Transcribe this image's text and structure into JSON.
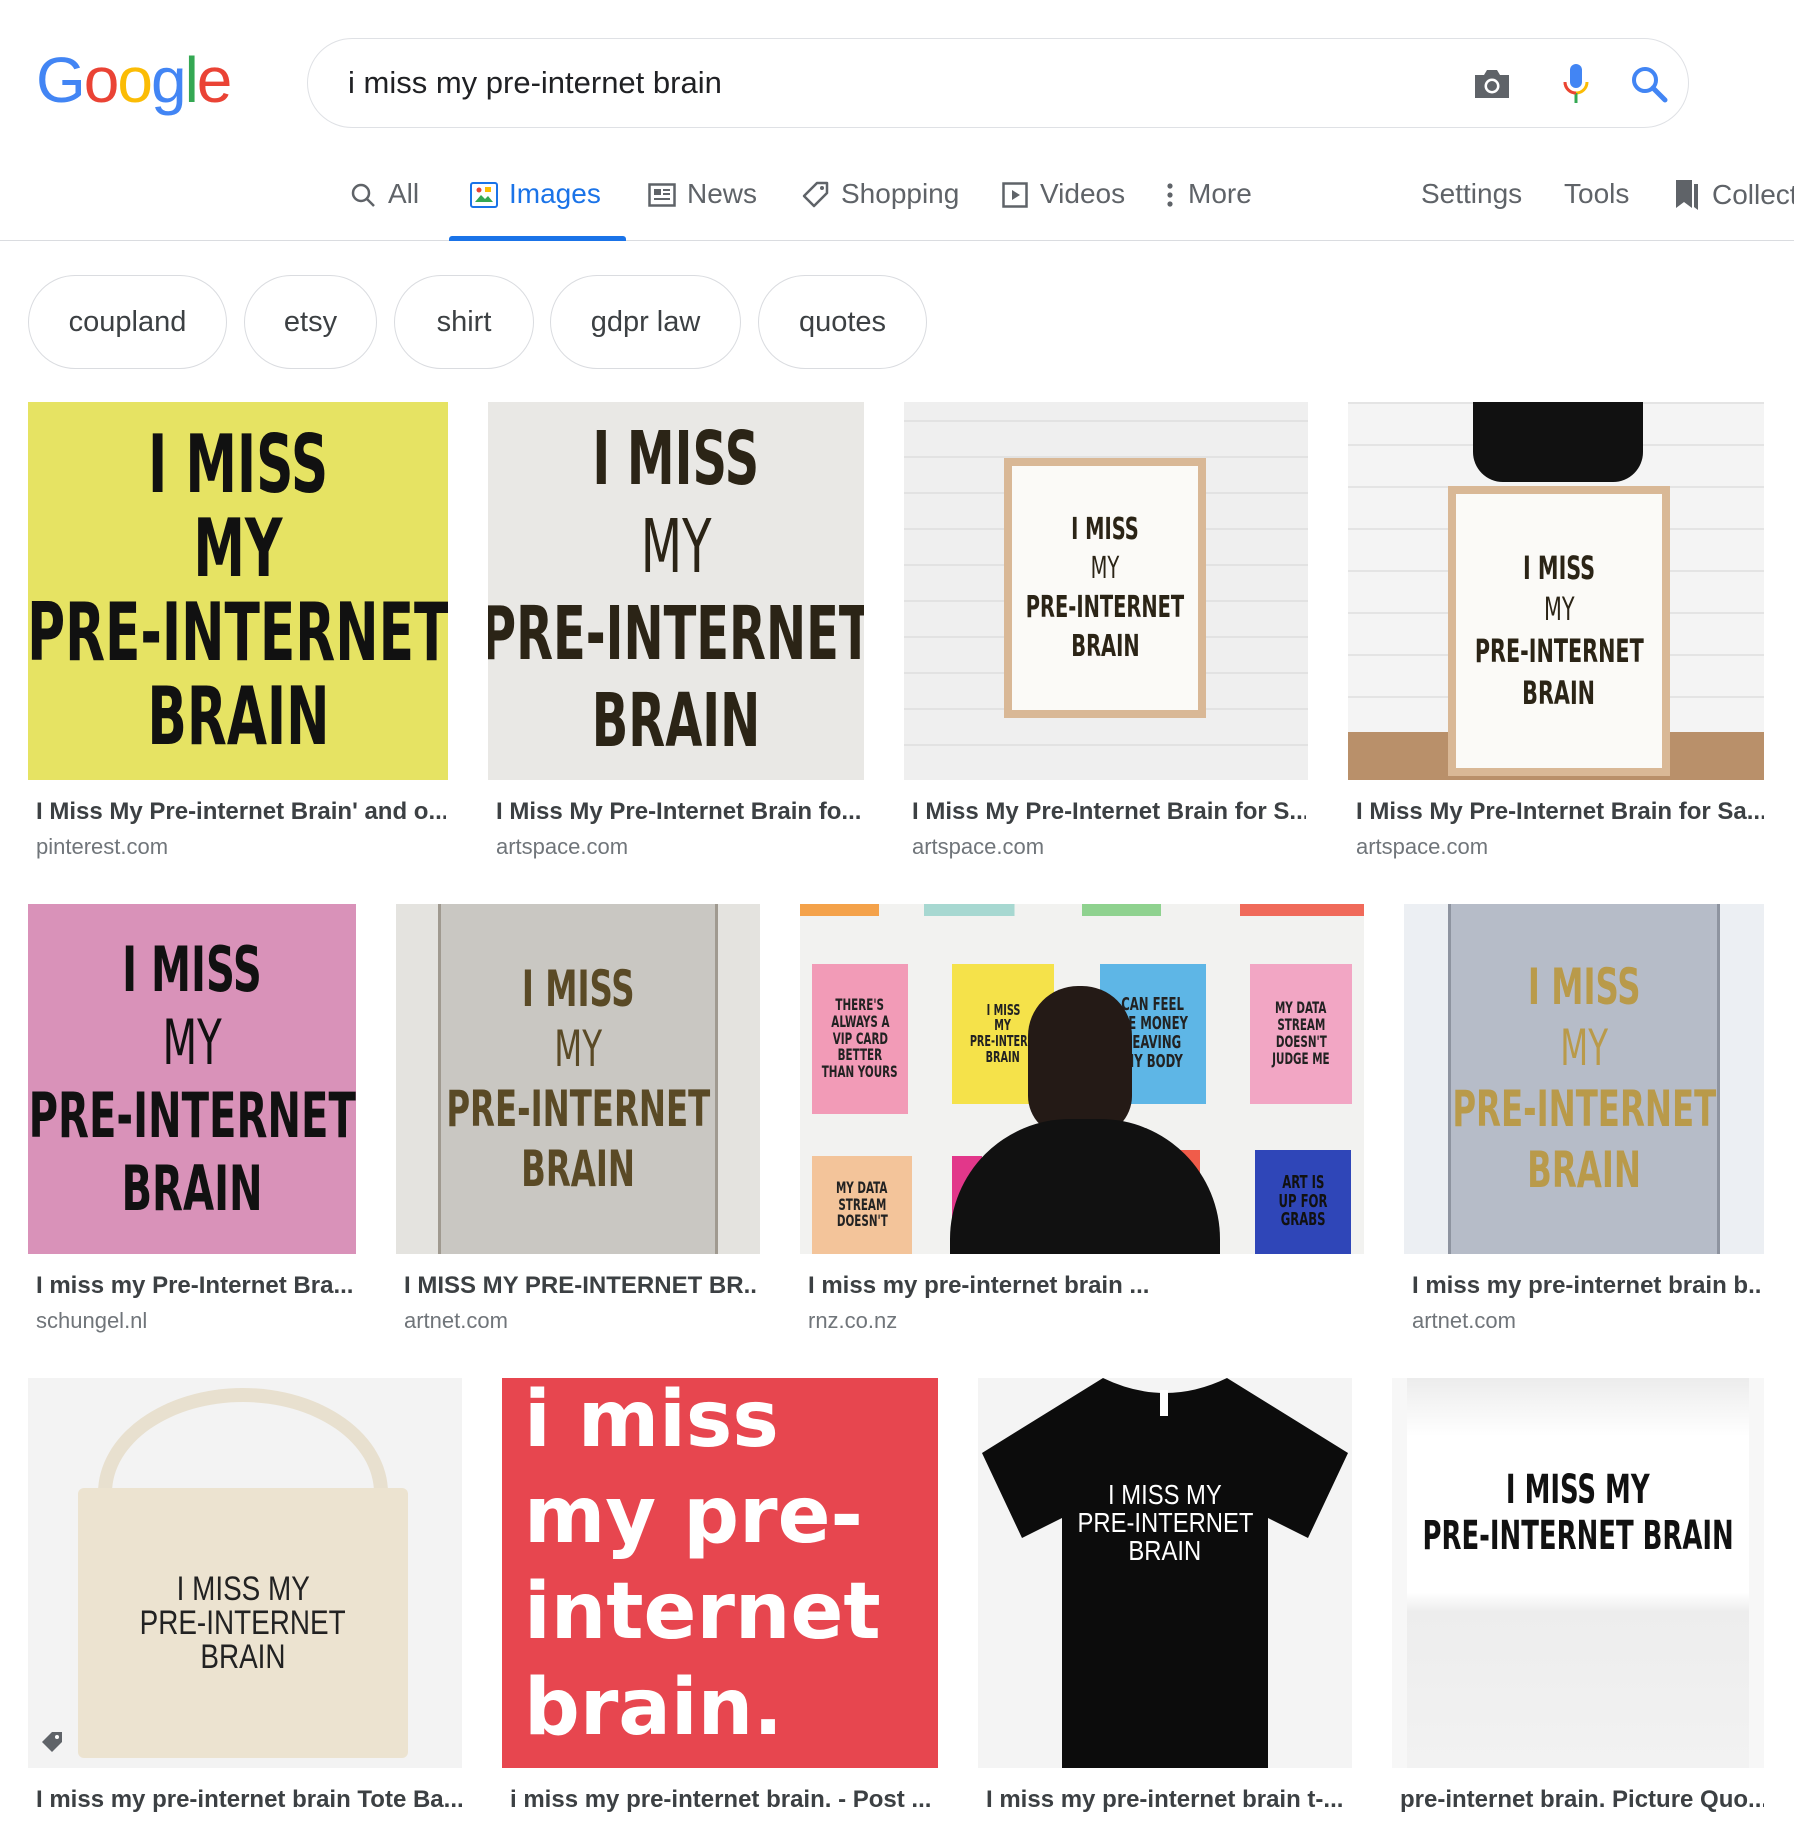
{
  "logo": {
    "letters": [
      "G",
      "o",
      "o",
      "g",
      "l",
      "e"
    ],
    "colors": [
      "#4285f4",
      "#ea4335",
      "#fbbc05",
      "#4285f4",
      "#34a853",
      "#ea4335"
    ]
  },
  "search": {
    "query": "i miss my pre-internet brain"
  },
  "tabs": {
    "all": "All",
    "images": "Images",
    "news": "News",
    "shopping": "Shopping",
    "videos": "Videos",
    "more": "More",
    "settings": "Settings",
    "tools": "Tools",
    "collections": "Collect"
  },
  "chips": [
    "coupland",
    "etsy",
    "shirt",
    "gdpr law",
    "quotes"
  ],
  "results": [
    {
      "title": "I Miss My Pre-internet Brain' and o...",
      "source": "pinterest.com",
      "poster_lines": [
        "I MISS",
        "MY",
        "PRE-INTERNET",
        "BRAIN"
      ]
    },
    {
      "title": "I Miss My Pre-Internet Brain fo...",
      "source": "artspace.com",
      "poster_lines": [
        "I MISS",
        "MY",
        "PRE-INTERNET",
        "BRAIN"
      ]
    },
    {
      "title": "I Miss My Pre-Internet Brain for S...",
      "source": "artspace.com",
      "poster_lines": [
        "I MISS",
        "MY",
        "PRE-INTERNET",
        "BRAIN"
      ]
    },
    {
      "title": "I Miss My Pre-Internet Brain for Sa...",
      "source": "artspace.com",
      "poster_lines": [
        "I MISS",
        "MY",
        "PRE-INTERNET",
        "BRAIN"
      ]
    },
    {
      "title": "I miss my Pre-Internet Bra...",
      "source": "schungel.nl",
      "poster_lines": [
        "I MISS",
        "MY",
        "PRE-INTERNET",
        "BRAIN"
      ]
    },
    {
      "title": "I MISS MY PRE-INTERNET BR...",
      "source": "artnet.com",
      "poster_lines": [
        "I MISS",
        "MY",
        "PRE-INTERNET",
        "BRAIN"
      ]
    },
    {
      "title": "I miss my pre-internet brain ...",
      "source": "rnz.co.nz",
      "posters": {
        "p1": [
          "THERE'S",
          "ALWAYS A",
          "VIP CARD",
          "BETTER",
          "THAN YOURS"
        ],
        "p2": [
          "I MISS",
          "MY",
          "PRE-INTERN",
          "BRAIN"
        ],
        "p3": [
          "CAN FEEL",
          "HE MONEY",
          "LEAVING",
          "MY BODY"
        ],
        "p4": [
          "MY DATA",
          "STREAM",
          "DOESN'T",
          "JUDGE ME"
        ],
        "p5": [
          "MY DATA",
          "STREAM",
          "DOESN'T"
        ],
        "p6": [
          "ART IS",
          "UP FOR",
          "GRABS"
        ]
      }
    },
    {
      "title": "I miss my pre-internet brain b...",
      "source": "artnet.com",
      "poster_lines": [
        "I MISS",
        "MY",
        "PRE-INTERNET",
        "BRAIN"
      ]
    },
    {
      "title": "I miss my pre-internet brain Tote Ba...",
      "source": "",
      "poster_lines": [
        "I MISS MY",
        "PRE-INTERNET",
        "BRAIN"
      ]
    },
    {
      "title": "i miss my pre-internet brain. - Post ...",
      "source": "",
      "poster_lines": [
        "i miss",
        "my pre-",
        "internet",
        "brain."
      ]
    },
    {
      "title": "I miss my pre-internet brain t-...",
      "source": "",
      "poster_lines": [
        "I MISS MY",
        "PRE-INTERNET",
        "BRAIN"
      ]
    },
    {
      "title": "pre-internet brain. Picture Quo...",
      "source": "",
      "poster_lines": [
        "I MISS MY",
        "PRE-INTERNET BRAIN"
      ]
    }
  ]
}
